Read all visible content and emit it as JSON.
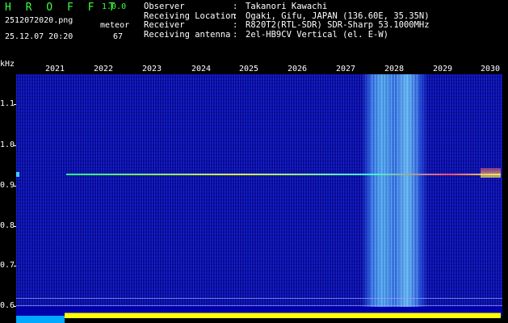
{
  "header": {
    "app_title": "H R O F F T",
    "app_version": "1.0.0",
    "file_name": "2512072020.png",
    "datetime": "25.12.07 20:20",
    "meteor_label": "meteor",
    "meteor_count": "67",
    "info": [
      {
        "key": "Observer",
        "sep": ":",
        "value": "Takanori Kawachi"
      },
      {
        "key": "Receiving Location",
        "sep": ":",
        "value": "Ogaki, Gifu, JAPAN (136.60E, 35.35N)"
      },
      {
        "key": "Receiver",
        "sep": ":",
        "value": "R820T2(RTL-SDR) SDR-Sharp 53.1000MHz"
      },
      {
        "key": "Receiving antenna",
        "sep": ":",
        "value": "2el-HB9CV Vertical (el. E-W)"
      }
    ]
  },
  "axis": {
    "unit": "kHz",
    "years": [
      "2021",
      "2022",
      "2023",
      "2024",
      "2025",
      "2026",
      "2027",
      "2028",
      "2029",
      "2030"
    ],
    "y_labels": [
      "1.1",
      "1.0",
      "0.9",
      "0.8",
      "0.7",
      "0.6"
    ]
  },
  "colors": {
    "title_green": "#3cff3c",
    "background": "#0b0ca6",
    "signal_trace": "#dfff3a",
    "floor_bar": "#ffff00"
  }
}
